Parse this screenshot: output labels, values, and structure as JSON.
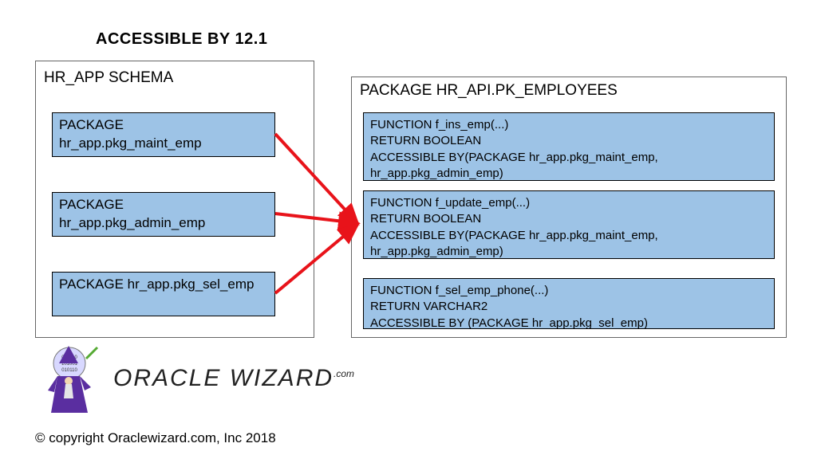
{
  "title": "ACCESSIBLE BY 12.1",
  "schema": {
    "title": "HR_APP SCHEMA",
    "packages": [
      "PACKAGE\nhr_app.pkg_maint_emp",
      "PACKAGE\nhr_app.pkg_admin_emp",
      "PACKAGE\nhr_app.pkg_sel_emp"
    ]
  },
  "api": {
    "title": "PACKAGE HR_API.PK_EMPLOYEES",
    "functions": [
      "FUNCTION f_ins_emp(...)\nRETURN BOOLEAN\nACCESSIBLE BY(PACKAGE hr_app.pkg_maint_emp,\nhr_app.pkg_admin_emp)",
      "FUNCTION f_update_emp(...)\nRETURN BOOLEAN\nACCESSIBLE BY(PACKAGE hr_app.pkg_maint_emp,\nhr_app.pkg_admin_emp)",
      "FUNCTION f_sel_emp_phone(...)\nRETURN VARCHAR2\nACCESSIBLE BY (PACKAGE hr_app.pkg_sel_emp)"
    ]
  },
  "logo_text": "ORACLE WIZARD",
  "logo_suffix": ".com",
  "copyright": "© copyright Oraclewizard.com, Inc 2018"
}
